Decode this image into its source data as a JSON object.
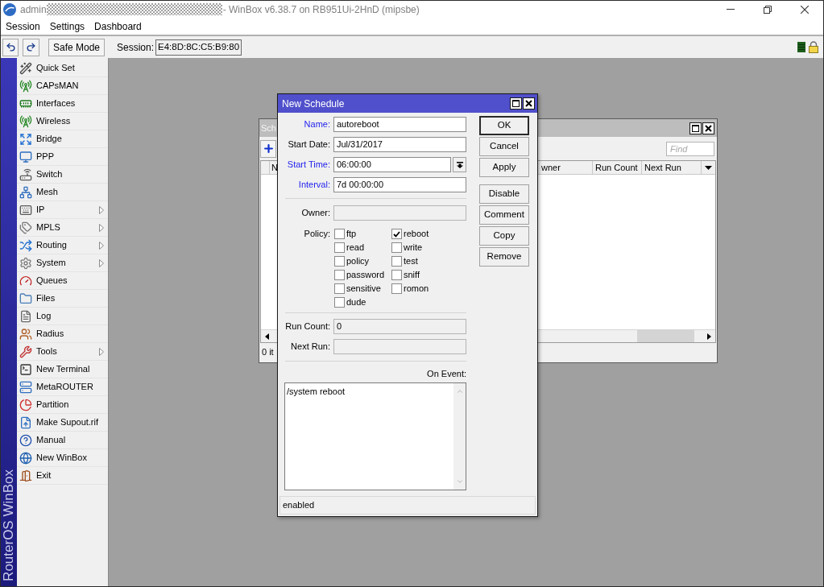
{
  "window": {
    "user": "admin",
    "title": "- WinBox v6.38.7 on RB951Ui-2HnD (mipsbe)"
  },
  "menu_bar": [
    {
      "label": "Session"
    },
    {
      "label": "Settings"
    },
    {
      "label": "Dashboard"
    }
  ],
  "toolbar": {
    "safe_mode": "Safe Mode",
    "session_label": "Session:",
    "session_value": "E4:8D:8C:C5:B9:80"
  },
  "sidebar": {
    "brand": "RouterOS WinBox",
    "items": [
      {
        "label": "Quick Set",
        "submenu": false
      },
      {
        "label": "CAPsMAN",
        "submenu": false
      },
      {
        "label": "Interfaces",
        "submenu": false
      },
      {
        "label": "Wireless",
        "submenu": false
      },
      {
        "label": "Bridge",
        "submenu": false
      },
      {
        "label": "PPP",
        "submenu": false
      },
      {
        "label": "Switch",
        "submenu": false
      },
      {
        "label": "Mesh",
        "submenu": false
      },
      {
        "label": "IP",
        "submenu": true
      },
      {
        "label": "MPLS",
        "submenu": true
      },
      {
        "label": "Routing",
        "submenu": true
      },
      {
        "label": "System",
        "submenu": true
      },
      {
        "label": "Queues",
        "submenu": false
      },
      {
        "label": "Files",
        "submenu": false
      },
      {
        "label": "Log",
        "submenu": false
      },
      {
        "label": "Radius",
        "submenu": false
      },
      {
        "label": "Tools",
        "submenu": true
      },
      {
        "label": "New Terminal",
        "submenu": false
      },
      {
        "label": "MetaROUTER",
        "submenu": false
      },
      {
        "label": "Partition",
        "submenu": false
      },
      {
        "label": "Make Supout.rif",
        "submenu": false
      },
      {
        "label": "Manual",
        "submenu": false
      },
      {
        "label": "New WinBox",
        "submenu": false
      },
      {
        "label": "Exit",
        "submenu": false
      }
    ]
  },
  "schedule_window": {
    "title": "Sch",
    "find": {
      "placeholder": "Find"
    },
    "columns": [
      "N",
      "wner",
      "Run Count",
      "Next Run"
    ],
    "status": "0 it"
  },
  "dialog": {
    "title": "New Schedule",
    "fields": [
      {
        "label": "Name:",
        "color": "#2323ee",
        "value": "autoreboot",
        "kind": "text",
        "disabled": false
      },
      {
        "label": "Start Date:",
        "color": "#000000",
        "value": "Jul/31/2017",
        "kind": "text",
        "disabled": false
      },
      {
        "label": "Start Time:",
        "color": "#2323ee",
        "value": "06:00:00",
        "kind": "dropdown",
        "disabled": false
      },
      {
        "label": "Interval:",
        "color": "#2323ee",
        "value": "7d 00:00:00",
        "kind": "text",
        "disabled": false
      }
    ],
    "owner": {
      "label": "Owner:",
      "disabled": true
    },
    "policy": {
      "label": "Policy:",
      "options": [
        {
          "label": "ftp",
          "checked": false
        },
        {
          "label": "reboot",
          "checked": true
        },
        {
          "label": "read",
          "checked": false
        },
        {
          "label": "write",
          "checked": false
        },
        {
          "label": "policy",
          "checked": false
        },
        {
          "label": "test",
          "checked": false
        },
        {
          "label": "password",
          "checked": false
        },
        {
          "label": "sniff",
          "checked": false
        },
        {
          "label": "sensitive",
          "checked": false
        },
        {
          "label": "romon",
          "checked": false
        },
        {
          "label": "dude",
          "checked": false
        }
      ]
    },
    "run_fields": [
      {
        "label": "Run Count:",
        "value": "0",
        "disabled": true
      },
      {
        "label": "Next Run:",
        "disabled": true
      }
    ],
    "on_event": {
      "label": "On Event:",
      "value": "/system reboot"
    },
    "button_groups": [
      {
        "buttons": [
          {
            "label": "OK",
            "default": true
          },
          {
            "label": "Cancel",
            "default": false
          },
          {
            "label": "Apply",
            "default": false
          }
        ]
      },
      {
        "buttons": [
          {
            "label": "Disable",
            "default": false
          },
          {
            "label": "Comment",
            "default": false
          },
          {
            "label": "Copy",
            "default": false
          },
          {
            "label": "Remove",
            "default": false
          }
        ]
      }
    ],
    "status": "enabled"
  }
}
